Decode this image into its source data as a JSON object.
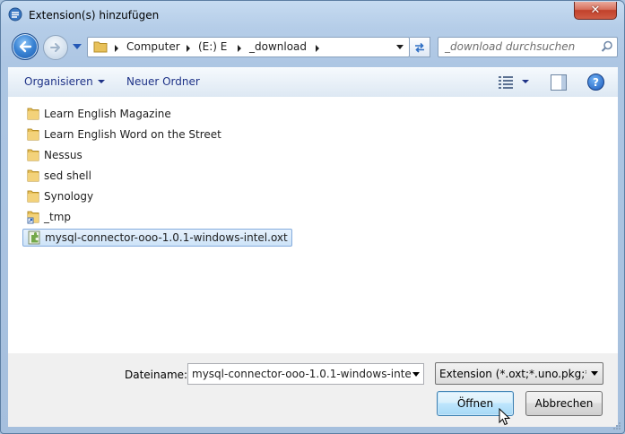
{
  "window": {
    "title": "Extension(s) hinzufügen",
    "close_label": "✕"
  },
  "nav": {
    "breadcrumbs": [
      "Computer",
      "(E:) E",
      "_download"
    ],
    "search_placeholder": "_download durchsuchen"
  },
  "toolbar": {
    "organize_label": "Organisieren",
    "new_folder_label": "Neuer Ordner",
    "help_label": "?"
  },
  "files": [
    {
      "name": "Learn English Magazine",
      "type": "folder"
    },
    {
      "name": "Learn English Word on the Street",
      "type": "folder"
    },
    {
      "name": "Nessus",
      "type": "folder"
    },
    {
      "name": "sed shell",
      "type": "folder"
    },
    {
      "name": "Synology",
      "type": "folder"
    },
    {
      "name": "_tmp",
      "type": "folder-shortcut"
    },
    {
      "name": "mysql-connector-ooo-1.0.1-windows-intel.oxt",
      "type": "extension",
      "selected": true
    }
  ],
  "footer": {
    "filename_label": "Dateiname:",
    "filename_value": "mysql-connector-ooo-1.0.1-windows-inte",
    "filter_value": "Extension (*.oxt;*.uno.pkg;*.zip)",
    "open_label": "Öffnen",
    "cancel_label": "Abbrechen"
  },
  "colors": {
    "folder": "#e8c15a",
    "accent": "#1e3287",
    "selection": "#cde3f8"
  }
}
